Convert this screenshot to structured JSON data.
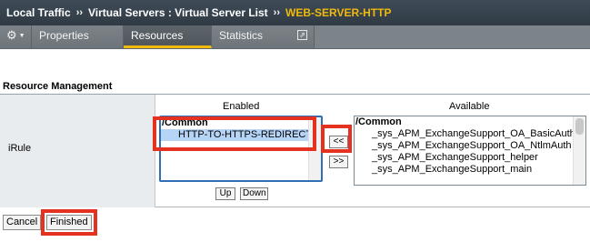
{
  "breadcrumb": {
    "items": [
      "Local Traffic",
      "Virtual Servers : Virtual Server List"
    ],
    "separator": "››",
    "current": "WEB-SERVER-HTTP"
  },
  "tabs": {
    "gear_icon": "gear-icon",
    "items": [
      {
        "label": "Properties"
      },
      {
        "label": "Resources",
        "active": true
      },
      {
        "label": "Statistics"
      }
    ],
    "external_icon": "⇗"
  },
  "section": {
    "title": "Resource Management"
  },
  "irule": {
    "row_label": "iRule",
    "enabled_header": "Enabled",
    "available_header": "Available",
    "enabled_list": {
      "group": "/Common",
      "items": [
        "HTTP-TO-HTTPS-REDIRECT"
      ]
    },
    "available_list": {
      "group": "/Common",
      "items": [
        "_sys_APM_ExchangeSupport_OA_BasicAuth",
        "_sys_APM_ExchangeSupport_OA_NtlmAuth",
        "_sys_APM_ExchangeSupport_helper",
        "_sys_APM_ExchangeSupport_main"
      ]
    },
    "move_left_label": "<<",
    "move_right_label": ">>",
    "up_label": "Up",
    "down_label": "Down"
  },
  "actions": {
    "cancel_label": "Cancel",
    "finished_label": "Finished"
  },
  "colors": {
    "accent": "#f1b90b",
    "highlight": "#e5311f",
    "selection": "#b6d4f5"
  }
}
